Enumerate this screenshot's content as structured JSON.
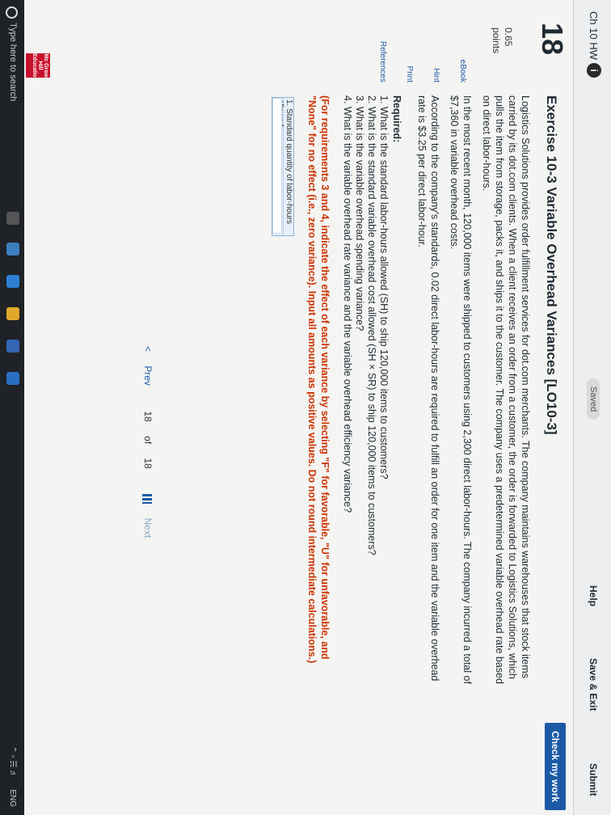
{
  "header": {
    "hw_title": "Ch 10 HW",
    "info_badge": "i",
    "saved_label": "Saved",
    "help_label": "Help",
    "save_exit_label": "Save & Exit",
    "submit_label": "Submit",
    "check_work_label": "Check my work"
  },
  "question": {
    "number": "18",
    "points_value": "0.65",
    "points_label": "points"
  },
  "sidebar": {
    "items": [
      {
        "label": "eBook"
      },
      {
        "label": "Hint"
      },
      {
        "label": "Print"
      },
      {
        "label": "References"
      }
    ]
  },
  "exercise": {
    "title": "Exercise 10-3 Variable Overhead Variances [LO10-3]",
    "para1": "Logistics Solutions provides order fulfillment services for dot.com merchants. The company maintains warehouses that stock items carried by its dot.com clients. When a client receives an order from a customer, the order is forwarded to Logistics Solutions, which pulls the item from storage, packs it, and ships it to the customer. The company uses a predetermined variable overhead rate based on direct labor-hours.",
    "para2": "In the most recent month, 120,000 items were shipped to customers using 2,300 direct labor-hours. The company incurred a total of $7,360 in variable overhead costs.",
    "para3": "According to the company's standards, 0.02 direct labor-hours are required to fulfill an order for one item and the variable overhead rate is $3.25 per direct labor-hour.",
    "required_label": "Required:",
    "requirements": [
      "1. What is the standard labor-hours allowed (SH) to ship 120,000 items to customers?",
      "2. What is the standard variable overhead cost allowed (SH × SR) to ship 120,000 items to customers?",
      "3. What is the variable overhead spending variance?",
      "4. What is the variable overhead rate variance and the variable overhead efficiency variance?"
    ],
    "instruction": "(For requirements 3 and 4, indicate the effect of each variance by selecting \"F\" for favorable, \"U\" for unfavorable, and \"None\" for no effect (i.e., zero variance). Input all amounts as positive values. Do not round intermediate calculations.)",
    "answer_row_label": "1. Standard quantity of labor-hours allowed"
  },
  "pager": {
    "prev_label": "Prev",
    "current": "18",
    "of_label": "of",
    "total": "18",
    "next_label": "Next"
  },
  "logo": {
    "text": "Mc Graw Hill Education"
  },
  "taskbar": {
    "search_placeholder": "Type here to search",
    "lang": "ENG",
    "icons": [
      "search-icon",
      "task-view-icon",
      "chrome-icon",
      "edge-icon",
      "file-explorer-icon",
      "store-icon",
      "mail-icon"
    ]
  }
}
